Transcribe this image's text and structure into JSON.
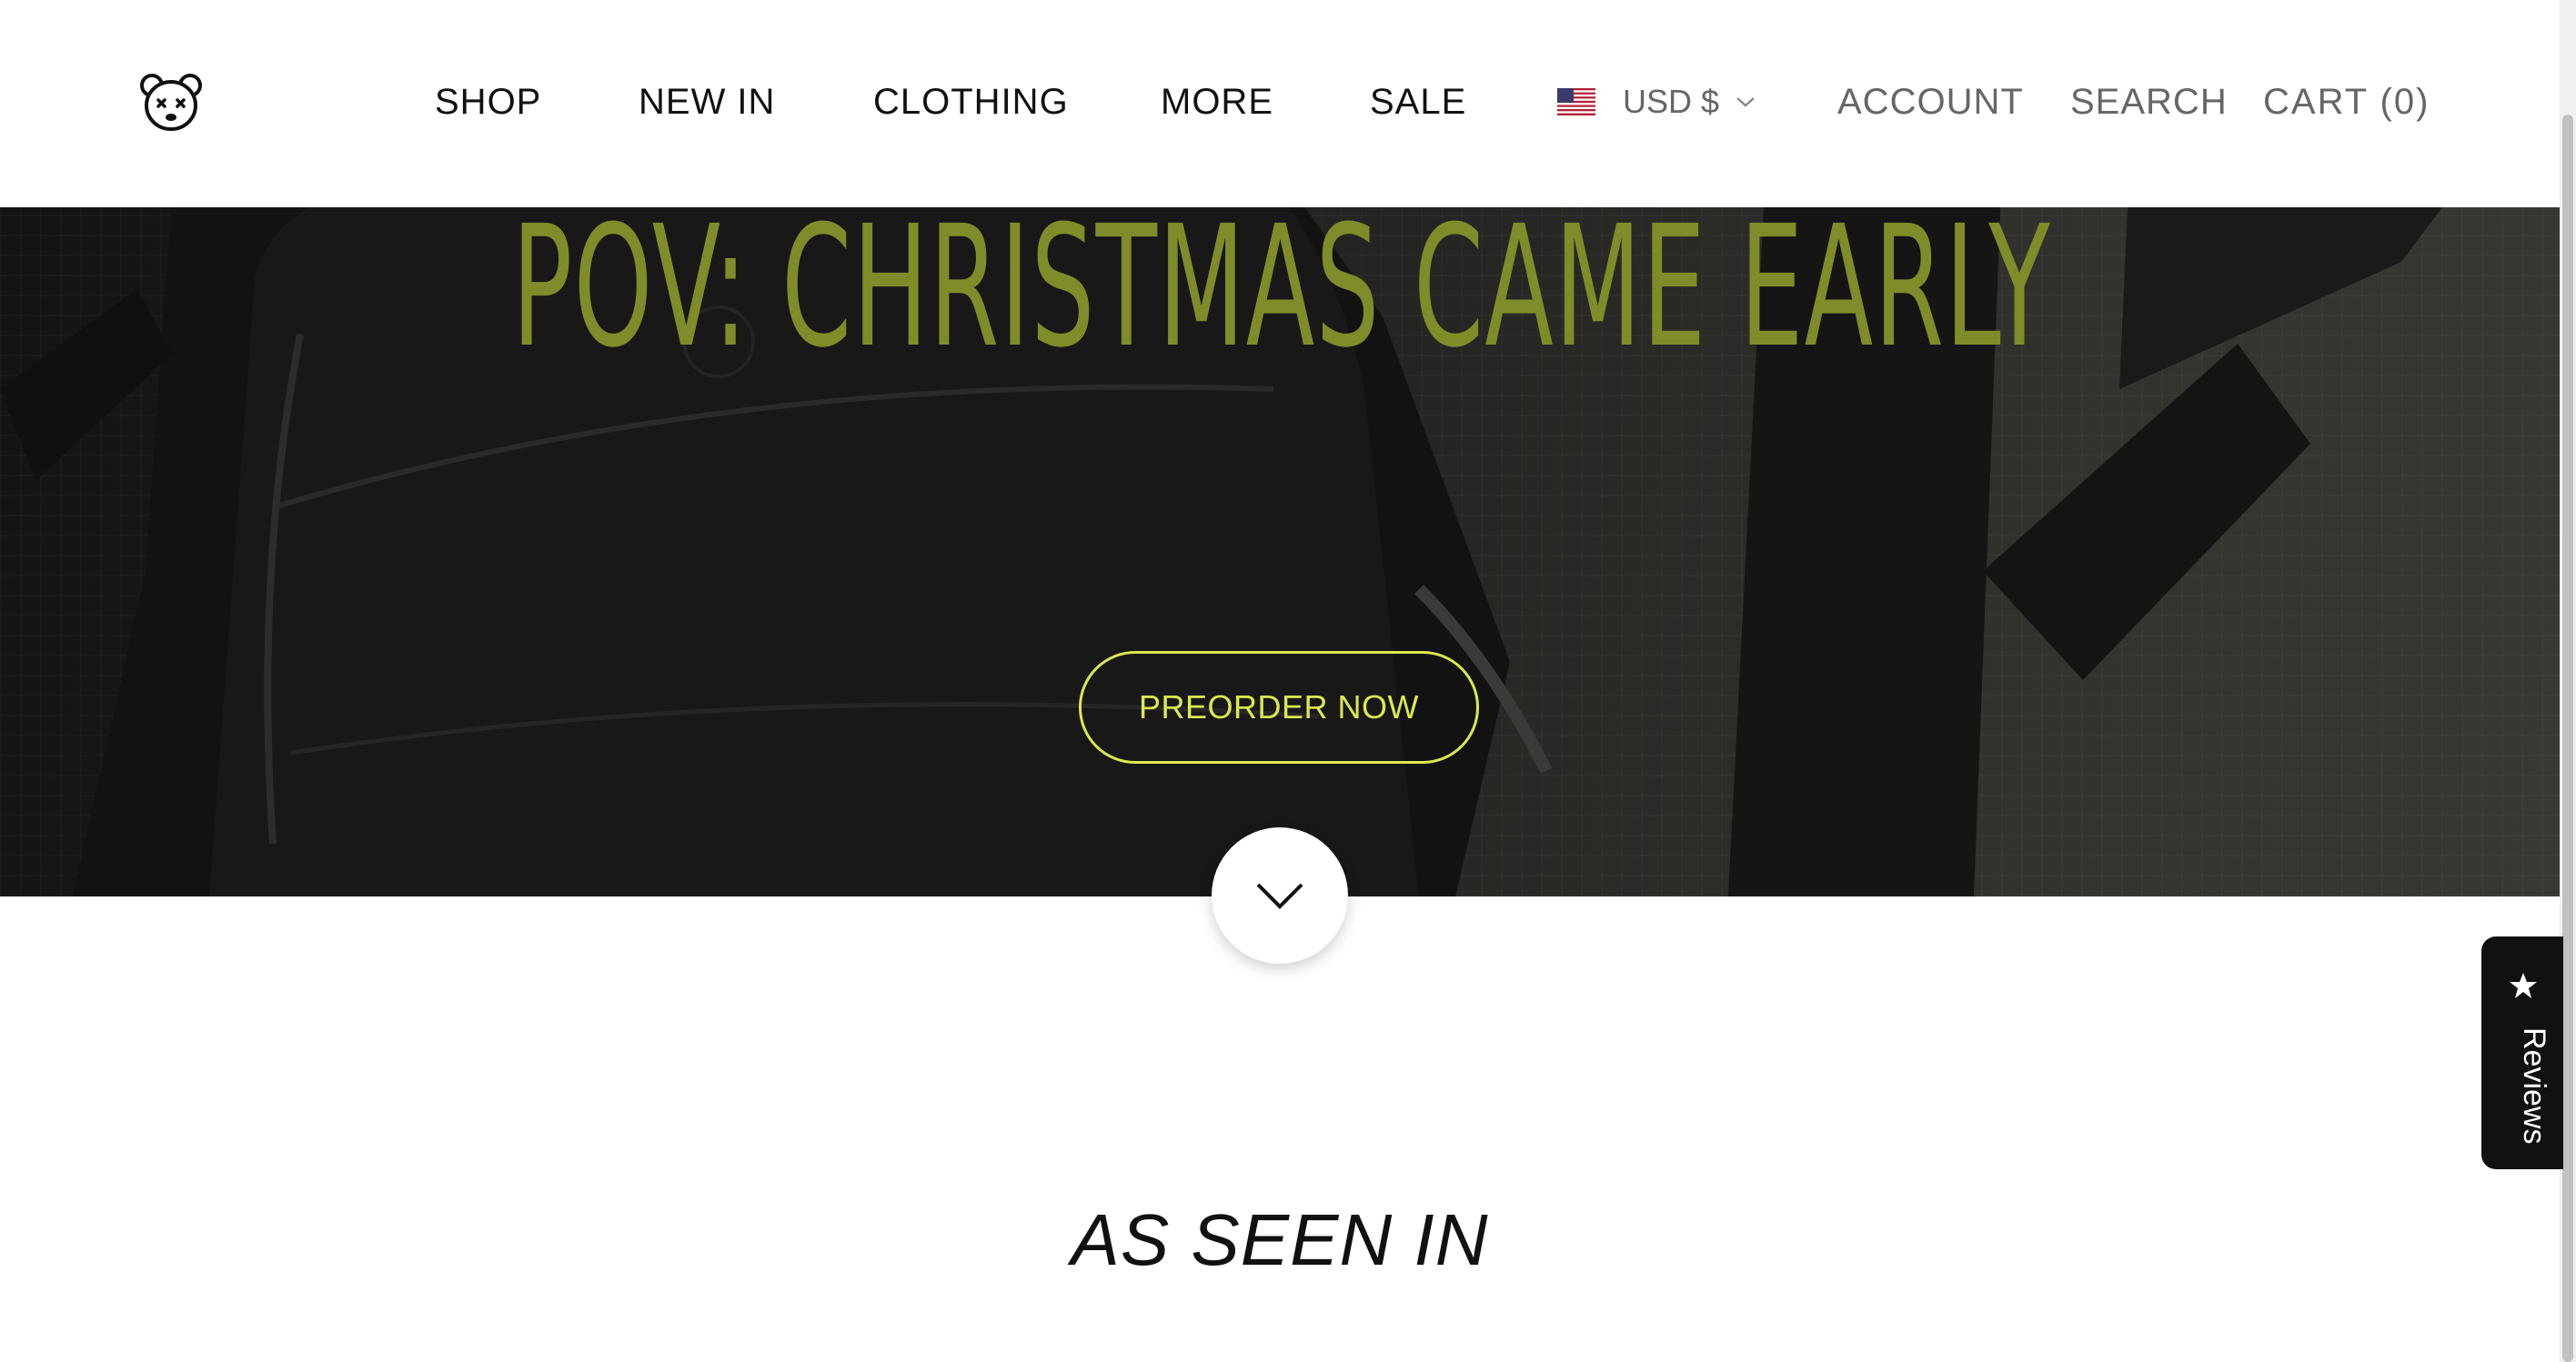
{
  "header": {
    "logo_icon": "bear-head-icon",
    "nav": [
      {
        "label": "SHOP"
      },
      {
        "label": "NEW IN"
      },
      {
        "label": "CLOTHING"
      },
      {
        "label": "MORE"
      },
      {
        "label": "SALE"
      }
    ],
    "currency": {
      "flag_icon": "us-flag-icon",
      "label": "USD $",
      "chevron_icon": "chevron-down-icon"
    },
    "account_label": "ACCOUNT",
    "search_label": "SEARCH",
    "cart_label": "CART (0)"
  },
  "hero": {
    "title": "POV: CHRISTMAS CAME EARLY",
    "button_label": "PREORDER NOW",
    "title_color": "#7f8c29",
    "button_color": "#dde84f"
  },
  "scroll_down": {
    "icon": "chevron-down-icon"
  },
  "section": {
    "heading": "AS SEEN IN"
  },
  "reviews_tab": {
    "label": "Reviews",
    "icon": "star-icon"
  }
}
